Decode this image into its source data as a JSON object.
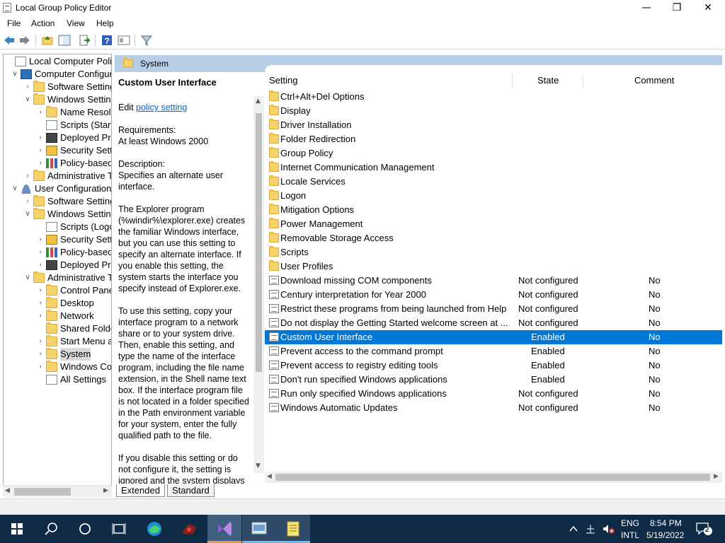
{
  "window": {
    "title": "Local Group Policy Editor",
    "minimize": "—",
    "maximize": "❐",
    "close": "✕"
  },
  "menu": [
    "File",
    "Action",
    "View",
    "Help"
  ],
  "toolbar_icons": [
    "back-icon",
    "forward-icon",
    "up-folder-icon",
    "show-hide-tree-icon",
    "export-list-icon",
    "help-icon",
    "properties-icon",
    "filter-icon"
  ],
  "tree": [
    {
      "label": "Local Computer Policy",
      "icon": "doc",
      "indent": 0,
      "exp": ""
    },
    {
      "label": "Computer Configuration",
      "icon": "pc",
      "indent": 1,
      "exp": "v"
    },
    {
      "label": "Software Settings",
      "icon": "folder",
      "indent": 2,
      "exp": ">"
    },
    {
      "label": "Windows Settings",
      "icon": "folder",
      "indent": 2,
      "exp": "v"
    },
    {
      "label": "Name Resolution Policy",
      "icon": "folder",
      "indent": 3,
      "exp": ">"
    },
    {
      "label": "Scripts (Startup/Shutdown)",
      "icon": "doc",
      "indent": 3,
      "exp": ""
    },
    {
      "label": "Deployed Printers",
      "icon": "prn",
      "indent": 3,
      "exp": ">"
    },
    {
      "label": "Security Settings",
      "icon": "lock",
      "indent": 3,
      "exp": ">"
    },
    {
      "label": "Policy-based QoS",
      "icon": "chart",
      "indent": 3,
      "exp": ">"
    },
    {
      "label": "Administrative Templates",
      "icon": "folder",
      "indent": 2,
      "exp": ">"
    },
    {
      "label": "User Configuration",
      "icon": "user",
      "indent": 1,
      "exp": "v"
    },
    {
      "label": "Software Settings",
      "icon": "folder",
      "indent": 2,
      "exp": ">"
    },
    {
      "label": "Windows Settings",
      "icon": "folder",
      "indent": 2,
      "exp": "v"
    },
    {
      "label": "Scripts (Logon/Logoff)",
      "icon": "doc",
      "indent": 3,
      "exp": ""
    },
    {
      "label": "Security Settings",
      "icon": "lock",
      "indent": 3,
      "exp": ">"
    },
    {
      "label": "Policy-based QoS",
      "icon": "chart",
      "indent": 3,
      "exp": ">"
    },
    {
      "label": "Deployed Printers",
      "icon": "prn",
      "indent": 3,
      "exp": ">"
    },
    {
      "label": "Administrative Templates",
      "icon": "folder",
      "indent": 2,
      "exp": "v"
    },
    {
      "label": "Control Panel",
      "icon": "folder",
      "indent": 3,
      "exp": ">"
    },
    {
      "label": "Desktop",
      "icon": "folder",
      "indent": 3,
      "exp": ">"
    },
    {
      "label": "Network",
      "icon": "folder",
      "indent": 3,
      "exp": ">"
    },
    {
      "label": "Shared Folders",
      "icon": "folder",
      "indent": 3,
      "exp": ""
    },
    {
      "label": "Start Menu and Taskbar",
      "icon": "folder",
      "indent": 3,
      "exp": ">"
    },
    {
      "label": "System",
      "icon": "folder",
      "indent": 3,
      "exp": ">",
      "selected": true
    },
    {
      "label": "Windows Components",
      "icon": "folder",
      "indent": 3,
      "exp": ">"
    },
    {
      "label": "All Settings",
      "icon": "doc",
      "indent": 3,
      "exp": ""
    }
  ],
  "pane_header": "System",
  "description": {
    "title": "Custom User Interface",
    "edit_prefix": "Edit",
    "edit_link": "policy setting",
    "requirements_label": "Requirements:",
    "requirements": "At least Windows 2000",
    "description_label": "Description:",
    "description": "Specifies an alternate user interface.",
    "para1": "The Explorer program (%windir%\\explorer.exe) creates the familiar Windows interface, but you can use this setting to specify an alternate interface. If you enable this setting, the system starts the interface you specify instead of Explorer.exe.",
    "para2": "To use this setting, copy your interface program to a network share or to your system drive. Then, enable this setting, and type the name of the interface program, including the file name extension, in the Shell name text box. If the interface program file is not located in a folder specified in the Path environment variable for your system, enter the fully qualified path to the file.",
    "para3": "If you disable this setting or do not configure it, the setting is ignored and the system displays the Explorer interface."
  },
  "columns": {
    "setting": "Setting",
    "state": "State",
    "comment": "Comment"
  },
  "rows": [
    {
      "name": "Ctrl+Alt+Del Options",
      "type": "folder",
      "state": "",
      "comment": ""
    },
    {
      "name": "Display",
      "type": "folder",
      "state": "",
      "comment": ""
    },
    {
      "name": "Driver Installation",
      "type": "folder",
      "state": "",
      "comment": ""
    },
    {
      "name": "Folder Redirection",
      "type": "folder",
      "state": "",
      "comment": ""
    },
    {
      "name": "Group Policy",
      "type": "folder",
      "state": "",
      "comment": ""
    },
    {
      "name": "Internet Communication Management",
      "type": "folder",
      "state": "",
      "comment": ""
    },
    {
      "name": "Locale Services",
      "type": "folder",
      "state": "",
      "comment": ""
    },
    {
      "name": "Logon",
      "type": "folder",
      "state": "",
      "comment": ""
    },
    {
      "name": "Mitigation Options",
      "type": "folder",
      "state": "",
      "comment": ""
    },
    {
      "name": "Power Management",
      "type": "folder",
      "state": "",
      "comment": ""
    },
    {
      "name": "Removable Storage Access",
      "type": "folder",
      "state": "",
      "comment": ""
    },
    {
      "name": "Scripts",
      "type": "folder",
      "state": "",
      "comment": ""
    },
    {
      "name": "User Profiles",
      "type": "folder",
      "state": "",
      "comment": ""
    },
    {
      "name": "Download missing COM components",
      "type": "setting",
      "state": "Not configured",
      "comment": "No"
    },
    {
      "name": "Century interpretation for Year 2000",
      "type": "setting",
      "state": "Not configured",
      "comment": "No"
    },
    {
      "name": "Restrict these programs from being launched from Help",
      "type": "setting",
      "state": "Not configured",
      "comment": "No"
    },
    {
      "name": "Do not display the Getting Started welcome screen at ...",
      "type": "setting",
      "state": "Not configured",
      "comment": "No"
    },
    {
      "name": "Custom User Interface",
      "type": "setting",
      "state": "Enabled",
      "comment": "No",
      "selected": true
    },
    {
      "name": "Prevent access to the command prompt",
      "type": "setting",
      "state": "Enabled",
      "comment": "No"
    },
    {
      "name": "Prevent access to registry editing tools",
      "type": "setting",
      "state": "Enabled",
      "comment": "No"
    },
    {
      "name": "Don't run specified Windows applications",
      "type": "setting",
      "state": "Enabled",
      "comment": "No"
    },
    {
      "name": "Run only specified Windows applications",
      "type": "setting",
      "state": "Not configured",
      "comment": "No"
    },
    {
      "name": "Windows Automatic Updates",
      "type": "setting",
      "state": "Not configured",
      "comment": "No"
    }
  ],
  "tabs": [
    "Extended",
    "Standard"
  ],
  "taskbar": {
    "icons": [
      "start-icon",
      "search-icon",
      "cortana-icon",
      "task-view-icon",
      "edge-icon",
      "app-icon",
      "visual-studio-icon",
      "group-policy-icon",
      "notepad-icon"
    ],
    "lang1": "ENG",
    "lang2": "INTL",
    "time": "8:54 PM",
    "date": "5/19/2022",
    "notifications": "2"
  },
  "colors": {
    "selection": "#0078d7",
    "pane_header": "#b8cde6",
    "taskbar": "#0f2a44",
    "link": "#0066cc"
  }
}
